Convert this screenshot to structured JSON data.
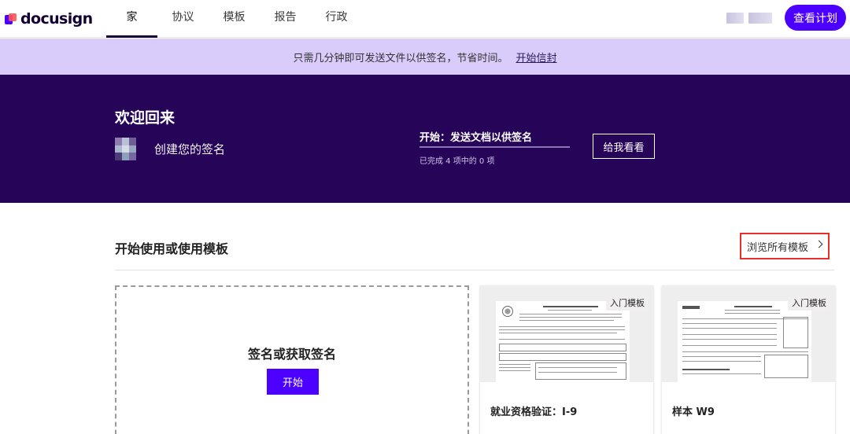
{
  "brand": {
    "name": "docusign"
  },
  "nav": {
    "tabs": [
      {
        "label": "家",
        "active": true
      },
      {
        "label": "协议",
        "active": false
      },
      {
        "label": "模板",
        "active": false
      },
      {
        "label": "报告",
        "active": false
      },
      {
        "label": "行政",
        "active": false
      }
    ],
    "plan_button": "查看计划"
  },
  "promo": {
    "text": "只需几分钟即可发送文件以供签名，节省时间。",
    "link": "开始信封"
  },
  "hero": {
    "title": "欢迎回来",
    "create_signature": "创建您的签名",
    "step_title": "开始：发送文档以供签名",
    "progress_fraction": 0,
    "progress_text": "已完成 4 项中的 0 项",
    "show_me_button": "给我看看"
  },
  "section": {
    "title": "开始使用或使用模板",
    "browse_link": "浏览所有模板"
  },
  "dropzone": {
    "title": "签名或获取签名",
    "start_button": "开始"
  },
  "templates": [
    {
      "badge": "入门模板",
      "name": "就业资格验证：I-9"
    },
    {
      "badge": "入门模板",
      "name": "样本 W9"
    }
  ],
  "colors": {
    "accent": "#4c00ff",
    "hero_bg": "#260559",
    "promo_bg": "#d9ccfb",
    "highlight_border": "#e5312a"
  },
  "icons": [
    "docusign-logo-icon",
    "chevron-right-icon",
    "signature-avatar-icon"
  ]
}
